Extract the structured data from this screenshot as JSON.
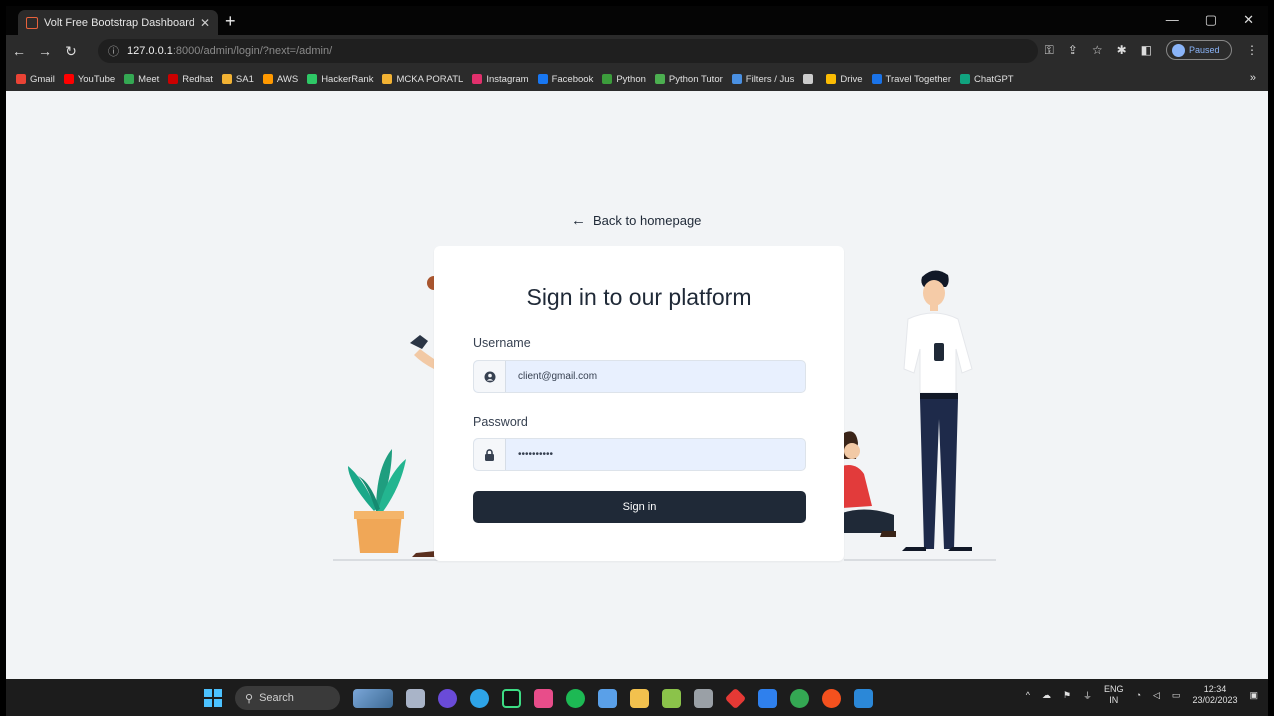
{
  "browser": {
    "tab_title": "Volt Free Bootstrap Dashboard",
    "url_host": "127.0.0.1",
    "url_path": ":8000/admin/login/?next=/admin/",
    "profile_label": "Paused",
    "bookmarks": [
      {
        "label": "Gmail",
        "color": "#ea4335"
      },
      {
        "label": "YouTube",
        "color": "#ff0000"
      },
      {
        "label": "Meet",
        "color": "#34a853"
      },
      {
        "label": "Redhat",
        "color": "#cc0000"
      },
      {
        "label": "SA1",
        "color": "#f2b233"
      },
      {
        "label": "AWS",
        "color": "#ff9900"
      },
      {
        "label": "HackerRank",
        "color": "#2ec866"
      },
      {
        "label": "MCKA PORATL",
        "color": "#f2b233"
      },
      {
        "label": "Instagram",
        "color": "#e1306c"
      },
      {
        "label": "Facebook",
        "color": "#1877f2"
      },
      {
        "label": "Python",
        "color": "#3c9d3c"
      },
      {
        "label": "Python Tutor",
        "color": "#4caf50"
      },
      {
        "label": "Filters / Jus",
        "color": "#4a90e2"
      },
      {
        "label": "",
        "color": "#cccccc"
      },
      {
        "label": "Drive",
        "color": "#fbbc04"
      },
      {
        "label": "Travel Together",
        "color": "#1a73e8"
      },
      {
        "label": "ChatGPT",
        "color": "#10a37f"
      }
    ]
  },
  "page": {
    "back_link": "Back to homepage",
    "title": "Sign in to our platform",
    "username_label": "Username",
    "username_value": "client@gmail.com",
    "password_label": "Password",
    "password_value": "••••••••••",
    "submit_label": "Sign in"
  },
  "taskbar": {
    "search_label": "Search",
    "lang": "ENG",
    "region": "IN",
    "time": "12:34",
    "date": "23/02/2023"
  }
}
